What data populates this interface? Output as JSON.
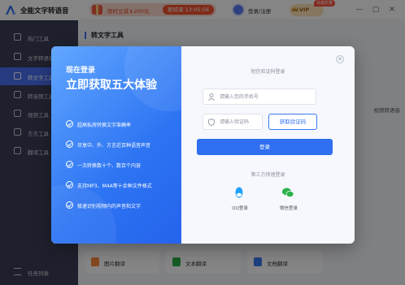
{
  "app": {
    "title": "全能文字转语音"
  },
  "promo": {
    "text": "限时立减￥200元",
    "countdown": "距结束 13:05:56"
  },
  "account": {
    "login_label": "登录/注册",
    "vip_label": "VIP",
    "vip_badge": "充值优惠"
  },
  "window": {
    "minimize": "—",
    "maximize": "▢",
    "close": "✕"
  },
  "sidebar": {
    "items": [
      {
        "label": "热门工具"
      },
      {
        "label": "文字转语音"
      },
      {
        "label": "转文字工具"
      },
      {
        "label": "转音频工具"
      },
      {
        "label": "视频工具"
      },
      {
        "label": "方言工具"
      },
      {
        "label": "翻译工具"
      }
    ],
    "task_list": "任务列表"
  },
  "main": {
    "title": "转文字工具",
    "side_hint": "视频转语音",
    "bottom_cards": [
      {
        "label": "图片翻译"
      },
      {
        "label": "文本翻译"
      },
      {
        "label": "文档翻译"
      }
    ]
  },
  "modal": {
    "heading": "现在登录",
    "subheading": "立即获取五大体验",
    "features": [
      "超高私房转换文字准确率",
      "尽享中、外、方言近百种语音声音",
      "一次转换数十个、数百个内容",
      "支持MP3、M4A等十余种文件格式",
      "极速识别视频内的声音和文字"
    ],
    "login_section_title": "短信验证码登录",
    "phone_placeholder": "请输入您的手机号",
    "code_placeholder": "请输入验证码",
    "get_code_label": "获取验证码",
    "login_button": "登录",
    "third_party_title": "第三方快速登录",
    "third_party": [
      {
        "label": "QQ登录"
      },
      {
        "label": "微信登录"
      }
    ],
    "close_icon": "✕"
  },
  "colors": {
    "accent": "#2f6ff0",
    "sidebar": "#3a3f57",
    "promo": "#f2532e",
    "qq": "#1ea1ff",
    "wechat": "#2ab24a"
  }
}
